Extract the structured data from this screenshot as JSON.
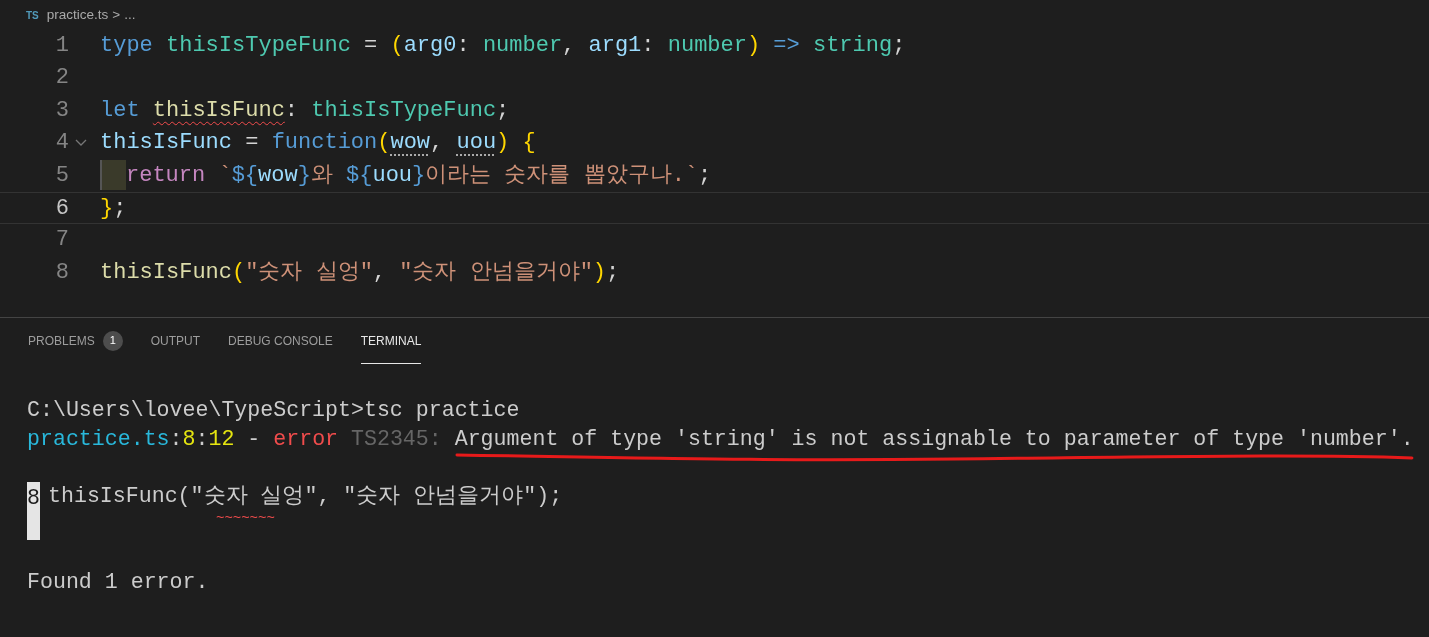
{
  "breadcrumb": {
    "file_badge": "TS",
    "file": "practice.ts",
    "separator": ">",
    "rest": "..."
  },
  "editor": {
    "lines": [
      {
        "number": "1",
        "current": false,
        "foldable": false,
        "tokens": [
          {
            "kind": "keyword",
            "text": "type "
          },
          {
            "kind": "type",
            "text": "thisIsTypeFunc"
          },
          {
            "kind": "plain",
            "text": " = "
          },
          {
            "kind": "bracket",
            "text": "("
          },
          {
            "kind": "param",
            "text": "arg0"
          },
          {
            "kind": "plain",
            "text": ": "
          },
          {
            "kind": "type",
            "text": "number"
          },
          {
            "kind": "plain",
            "text": ", "
          },
          {
            "kind": "param",
            "text": "arg1"
          },
          {
            "kind": "plain",
            "text": ": "
          },
          {
            "kind": "type",
            "text": "number"
          },
          {
            "kind": "bracket",
            "text": ")"
          },
          {
            "kind": "keyword",
            "text": " => "
          },
          {
            "kind": "type",
            "text": "string"
          },
          {
            "kind": "plain",
            "text": ";"
          }
        ]
      },
      {
        "number": "2",
        "current": false,
        "foldable": false
      },
      {
        "number": "3",
        "current": false,
        "foldable": false,
        "tokens": [
          {
            "kind": "keyword",
            "text": "let "
          },
          {
            "kind": "function",
            "text": "thisIsFunc",
            "error": true
          },
          {
            "kind": "plain",
            "text": ": "
          },
          {
            "kind": "type",
            "text": "thisIsTypeFunc"
          },
          {
            "kind": "plain",
            "text": ";"
          }
        ]
      },
      {
        "number": "4",
        "current": false,
        "foldable": true,
        "tokens": [
          {
            "kind": "param",
            "text": "thisIsFunc"
          },
          {
            "kind": "plain",
            "text": " = "
          },
          {
            "kind": "keyword",
            "text": "function"
          },
          {
            "kind": "bracket",
            "text": "("
          },
          {
            "kind": "param",
            "text": "wow",
            "hint": true
          },
          {
            "kind": "plain",
            "text": ", "
          },
          {
            "kind": "param",
            "text": "uou",
            "hint": true
          },
          {
            "kind": "bracket",
            "text": ") {"
          }
        ]
      },
      {
        "number": "5",
        "current": false,
        "foldable": false,
        "indent": true,
        "tokens": [
          {
            "kind": "control",
            "text": "return "
          },
          {
            "kind": "string",
            "text": "`"
          },
          {
            "kind": "keyword",
            "text": "${"
          },
          {
            "kind": "param",
            "text": "wow"
          },
          {
            "kind": "keyword",
            "text": "}"
          },
          {
            "kind": "string",
            "text": "와 "
          },
          {
            "kind": "keyword",
            "text": "${"
          },
          {
            "kind": "param",
            "text": "uou"
          },
          {
            "kind": "keyword",
            "text": "}"
          },
          {
            "kind": "string",
            "text": "이라는 숫자를 뽑았구나.`"
          },
          {
            "kind": "plain",
            "text": ";"
          }
        ]
      },
      {
        "number": "6",
        "current": true,
        "foldable": false,
        "tokens": [
          {
            "kind": "bracket",
            "text": "}"
          },
          {
            "kind": "plain",
            "text": ";"
          }
        ]
      },
      {
        "number": "7",
        "current": false,
        "foldable": false
      },
      {
        "number": "8",
        "current": false,
        "foldable": false,
        "tokens": [
          {
            "kind": "function",
            "text": "thisIsFunc"
          },
          {
            "kind": "bracket",
            "text": "("
          },
          {
            "kind": "string",
            "text": "\"숫자 실엉\""
          },
          {
            "kind": "plain",
            "text": ", "
          },
          {
            "kind": "string",
            "text": "\"숫자 안넘을거야\""
          },
          {
            "kind": "bracket",
            "text": ")"
          },
          {
            "kind": "plain",
            "text": ";"
          }
        ]
      }
    ]
  },
  "panel": {
    "tabs": [
      {
        "label": "PROBLEMS",
        "badge": "1",
        "selected": false
      },
      {
        "label": "OUTPUT",
        "selected": false
      },
      {
        "label": "DEBUG CONSOLE",
        "selected": false
      },
      {
        "label": "TERMINAL",
        "selected": true
      }
    ]
  },
  "terminal": {
    "lines": [
      {
        "kind": "text",
        "segments": [
          {
            "kind": "plain",
            "text": "C:\\Users\\lovee\\TypeScript>tsc practice"
          }
        ]
      },
      {
        "kind": "text",
        "segments": [
          {
            "kind": "path",
            "text": "practice.ts"
          },
          {
            "kind": "plain",
            "text": ":"
          },
          {
            "kind": "number",
            "text": "8"
          },
          {
            "kind": "plain",
            "text": ":"
          },
          {
            "kind": "number",
            "text": "12"
          },
          {
            "kind": "plain",
            "text": " - "
          },
          {
            "kind": "error",
            "text": "error"
          },
          {
            "kind": "muted",
            "text": " TS2345: "
          },
          {
            "kind": "plain",
            "text": "Argument of type 'string' is not assignable to parameter of type 'number'.",
            "highlighted": true
          }
        ]
      },
      {
        "kind": "blank"
      },
      {
        "kind": "source",
        "gutter": "8",
        "code": "thisIsFunc(\"숫자 실엉\", \"숫자 안넘을거야\");",
        "squiggle": "~~~~~~~"
      },
      {
        "kind": "blank"
      },
      {
        "kind": "text",
        "segments": [
          {
            "kind": "plain",
            "text": "Found 1 error."
          }
        ]
      }
    ]
  }
}
